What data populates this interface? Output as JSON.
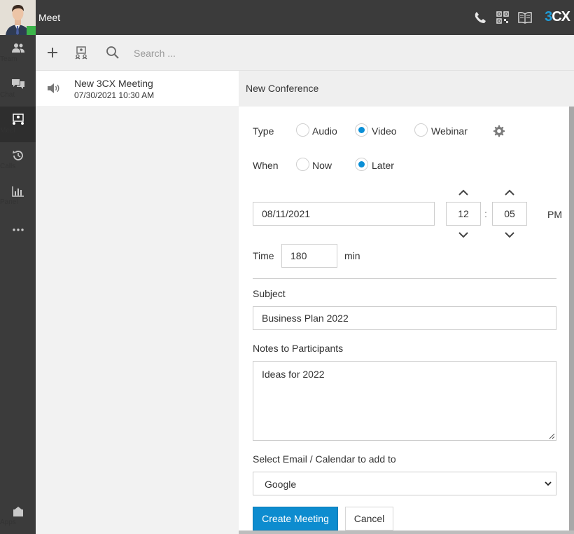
{
  "app": {
    "title": "Meet",
    "brand_number": "3",
    "brand_letters": "CX"
  },
  "nav": {
    "items": [
      {
        "label": "Team",
        "icon": "team-icon"
      },
      {
        "label": "Chat",
        "icon": "chat-icon"
      },
      {
        "label": "Meet",
        "icon": "meet-icon"
      },
      {
        "label": "Calls",
        "icon": "calls-icon"
      },
      {
        "label": "Panel",
        "icon": "panel-icon"
      },
      {
        "label": "",
        "icon": "more-icon"
      }
    ],
    "apps_label": "Apps"
  },
  "toolbar": {
    "search_placeholder": "Search ..."
  },
  "meetings": [
    {
      "name": "New 3CX Meeting",
      "date": "07/30/2021 10:30 AM"
    }
  ],
  "conference": {
    "header": "New Conference",
    "type_label": "Type",
    "type_options": [
      "Audio",
      "Video",
      "Webinar"
    ],
    "type_selected": "Video",
    "when_label": "When",
    "when_options": [
      "Now",
      "Later"
    ],
    "when_selected": "Later",
    "date": "08/11/2021",
    "hour": "12",
    "time_sep": ":",
    "minute": "05",
    "ampm": "PM",
    "time_label": "Time",
    "duration": "180",
    "duration_unit": "min",
    "subject_label": "Subject",
    "subject": "Business Plan 2022",
    "notes_label": "Notes to Participants",
    "notes": "Ideas for 2022",
    "calendar_label": "Select Email / Calendar to add to",
    "calendar_selected": "Google",
    "create_button": "Create Meeting",
    "cancel_button": "Cancel"
  },
  "colors": {
    "accent": "#0d8ccf",
    "nav_bg": "#3b3b3b",
    "presence": "#3cb44a",
    "brand_blue": "#1e9bd7"
  }
}
